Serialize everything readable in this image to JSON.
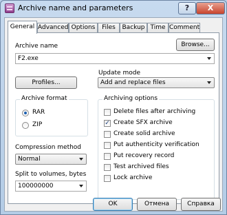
{
  "window": {
    "title": "Archive name and parameters",
    "help_glyph": "?",
    "close_glyph": "X",
    "icon": "winrar-books-icon"
  },
  "tabs": [
    {
      "label": "General",
      "active": true
    },
    {
      "label": "Advanced",
      "active": false
    },
    {
      "label": "Options",
      "active": false
    },
    {
      "label": "Files",
      "active": false
    },
    {
      "label": "Backup",
      "active": false
    },
    {
      "label": "Time",
      "active": false
    },
    {
      "label": "Comment",
      "active": false
    }
  ],
  "general": {
    "archive_name_label": "Archive name",
    "browse_button": "Browse...",
    "archive_name_value": "F2.exe",
    "profiles_button": "Profiles...",
    "update_mode_label": "Update mode",
    "update_mode_value": "Add and replace files",
    "archive_format": {
      "title": "Archive format",
      "options": [
        {
          "label": "RAR",
          "selected": true
        },
        {
          "label": "ZIP",
          "selected": false
        }
      ]
    },
    "compression_method_label": "Compression method",
    "compression_method_value": "Normal",
    "split_label": "Split to volumes, bytes",
    "split_value": "100000000",
    "archiving_options": {
      "title": "Archiving options",
      "options": [
        {
          "label": "Delete files after archiving",
          "checked": false
        },
        {
          "label": "Create SFX archive",
          "checked": true
        },
        {
          "label": "Create solid archive",
          "checked": false
        },
        {
          "label": "Put authenticity verification",
          "checked": false
        },
        {
          "label": "Put recovery record",
          "checked": false
        },
        {
          "label": "Test archived files",
          "checked": false
        },
        {
          "label": "Lock archive",
          "checked": false
        }
      ]
    }
  },
  "buttons": {
    "ok": "OK",
    "cancel": "Отмена",
    "help": "Справка"
  }
}
